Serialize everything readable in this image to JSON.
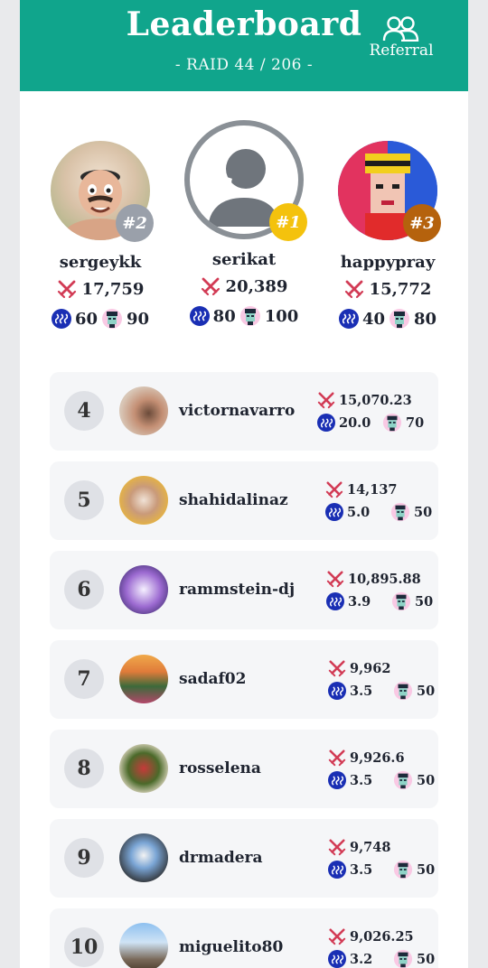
{
  "header": {
    "title": "Leaderboard",
    "subtitle": "- RAID 44 / 206 -",
    "referral_label": "Referral"
  },
  "podium": [
    {
      "place": "second",
      "rank": "#2",
      "name": "sergeykk",
      "score": "17,759",
      "steem": "60",
      "tokens": "90",
      "badge_color": "#9aa0aa"
    },
    {
      "place": "first",
      "rank": "#1",
      "name": "serikat",
      "score": "20,389",
      "steem": "80",
      "tokens": "100",
      "badge_color": "#f4c20d"
    },
    {
      "place": "third",
      "rank": "#3",
      "name": "happypray",
      "score": "15,772",
      "steem": "40",
      "tokens": "80",
      "badge_color": "#b5620d"
    }
  ],
  "rows": [
    {
      "rank": "4",
      "name": "victornavarro",
      "score": "15,070.23",
      "steem": "20.0",
      "tokens": "70"
    },
    {
      "rank": "5",
      "name": "shahidalinaz",
      "score": "14,137",
      "steem": "5.0",
      "tokens": "50"
    },
    {
      "rank": "6",
      "name": "rammstein-dj",
      "score": "10,895.88",
      "steem": "3.9",
      "tokens": "50"
    },
    {
      "rank": "7",
      "name": "sadaf02",
      "score": "9,962",
      "steem": "3.5",
      "tokens": "50"
    },
    {
      "rank": "8",
      "name": "rosselena",
      "score": "9,926.6",
      "steem": "3.5",
      "tokens": "50"
    },
    {
      "rank": "9",
      "name": "drmadera",
      "score": "9,748",
      "steem": "3.5",
      "tokens": "50"
    },
    {
      "rank": "10",
      "name": "miguelito80",
      "score": "9,026.25",
      "steem": "3.2",
      "tokens": "50"
    }
  ],
  "colors": {
    "header": "#10a58c",
    "steem": "#1a2fb4",
    "sword": "#d23b55",
    "row_bg": "#f5f6f8"
  },
  "icons": [
    "users-icon",
    "crossed-swords-icon",
    "steem-icon",
    "token-face-icon",
    "default-avatar-icon"
  ]
}
